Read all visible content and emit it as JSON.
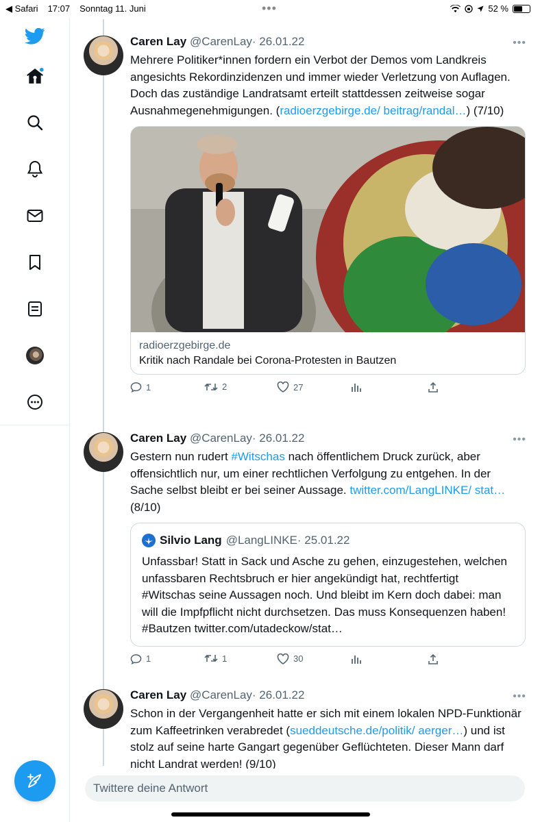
{
  "status_bar": {
    "back_app": "◀ Safari",
    "time": "17:07",
    "date": "Sonntag 11. Juni",
    "battery": "52 %"
  },
  "sidebar": {
    "items": [
      {
        "icon": "twitter-logo-icon"
      },
      {
        "icon": "home-icon"
      },
      {
        "icon": "search-icon"
      },
      {
        "icon": "notifications-bell-icon"
      },
      {
        "icon": "messages-envelope-icon"
      },
      {
        "icon": "bookmark-icon"
      },
      {
        "icon": "lists-icon"
      },
      {
        "icon": "profile-avatar-icon"
      },
      {
        "icon": "more-circle-icon"
      }
    ],
    "compose_icon": "compose-tweet-icon"
  },
  "colors": {
    "accent": "#1d9bf0",
    "text": "#0f1419",
    "muted": "#536471",
    "border": "#cfd9de"
  },
  "tweets": [
    {
      "name": "Caren Lay",
      "handle": "@CarenLay",
      "date": "· 26.01.22",
      "text_before": "Mehrere Politiker*innen fordern ein Verbot der Demos vom Landkreis angesichts Rekordinzidenzen und immer wieder Verletzung von Auflagen. Doch das zuständige Landratsamt erteilt stattdessen zeitweise sogar Ausnahmegenehmigungen. (",
      "link": "radioerzgebirge.de/ beitrag/randal…",
      "text_after": ") (7/10)",
      "card": {
        "domain": "radioerzgebirge.de",
        "title": "Kritik nach Randale bei Corona-Protesten in Bautzen"
      },
      "replies": "1",
      "retweets": "2",
      "likes": "27"
    },
    {
      "name": "Caren Lay",
      "handle": "@CarenLay",
      "date": "· 26.01.22",
      "text_1": "Gestern nun rudert ",
      "hashtag": "#Witschas",
      "text_2": " nach öffentlichem Druck zurück, aber offensichtlich nur, um einer rechtlichen Verfolgung zu entgehen. In der Sache selbst bleibt er bei seiner Aussage. ",
      "link": "twitter.com/LangLINKE/ stat…",
      "text_3": "  (8/10)",
      "quote": {
        "name": "Silvio Lang",
        "handle": "@LangLINKE",
        "date": "· 25.01.22",
        "text": "Unfassbar! Statt in Sack und Asche zu gehen, einzugestehen, welchen unfassbaren Rechtsbruch er hier angekündigt hat, rechtfertigt #Witschas seine Aussagen noch. Und bleibt im Kern doch dabei: man will die Impfpflicht nicht durchsetzen. Das muss Konsequenzen haben! #Bautzen twitter.com/utadeckow/stat…"
      },
      "replies": "1",
      "retweets": "1",
      "likes": "30"
    },
    {
      "name": "Caren Lay",
      "handle": "@CarenLay",
      "date": "· 26.01.22",
      "text_before": "Schon in der Vergangenheit hatte er sich mit einem lokalen NPD-Funktionär zum Kaffeetrinken verabredet (",
      "link": "sueddeutsche.de/politik/ aerger…",
      "text_after": ") und ist stolz auf seine harte Gangart gegenüber Geflüchteten. Dieser Mann darf nicht Landrat werden! (9/10)"
    }
  ],
  "reply_bar": {
    "placeholder": "Twittere deine Antwort"
  }
}
